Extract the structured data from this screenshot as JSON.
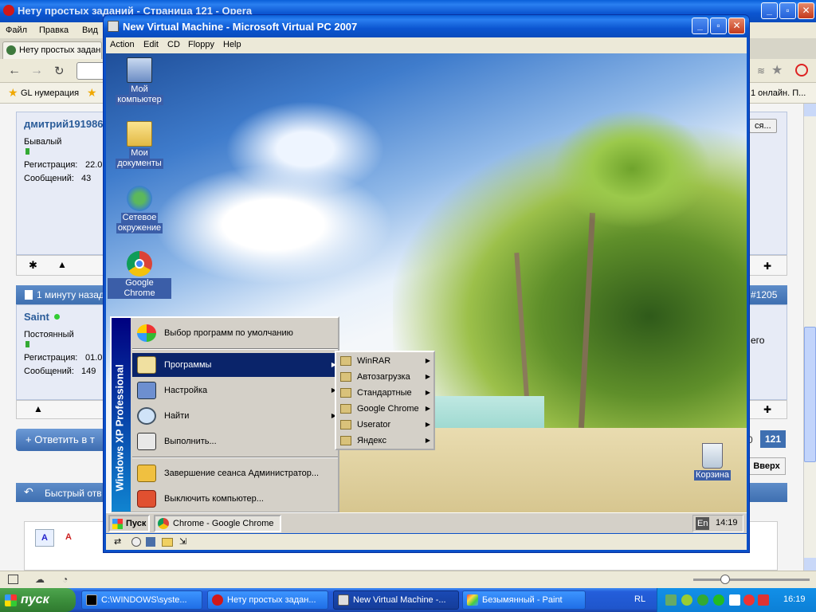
{
  "opera": {
    "window_title": "Нету простых заданий - Страница 121 - Opera",
    "menu": [
      "Файл",
      "Правка",
      "Вид"
    ],
    "tab_title": "Нету простых задан...",
    "bookmark": "GL нумерация",
    "status_right": "1 онлайн. П...",
    "button_right": "ся...",
    "post1": {
      "username": "дмитрий191986",
      "rank": "Бывалый",
      "reg_label": "Регистрация:",
      "reg_value": "22.0",
      "msgs_label": "Сообщений:",
      "msgs_value": "43"
    },
    "post2_header": "1 минуту назад",
    "post2_num": "#1205",
    "post2": {
      "username": "Saint",
      "rank": "Постоянный",
      "reg_label": "Регистрация:",
      "reg_value": "01.0",
      "msgs_label": "Сообщений:",
      "msgs_value": "149"
    },
    "right_text": "его",
    "reply_button": "+ Ответить в т",
    "page_prev": "0",
    "page_current": "121",
    "up_button": "Вверх",
    "quick_reply": "Быстрый отв"
  },
  "vpc": {
    "title": "New Virtual Machine - Microsoft Virtual PC 2007",
    "menu": [
      "Action",
      "Edit",
      "CD",
      "Floppy",
      "Help"
    ]
  },
  "desktop_icons": [
    {
      "label1": "Мой",
      "label2": "компьютер"
    },
    {
      "label1": "Мои",
      "label2": "документы"
    },
    {
      "label1": "Сетевое",
      "label2": "окружение"
    },
    {
      "label1": "Google Chrome",
      "label2": ""
    },
    {
      "label1": "Корзина",
      "label2": ""
    }
  ],
  "start_menu": {
    "banner": "Windows XP Professional",
    "items": [
      "Выбор программ по умолчанию",
      "Программы",
      "Настройка",
      "Найти",
      "Выполнить...",
      "Завершение сеанса Администратор...",
      "Выключить компьютер..."
    ]
  },
  "programs_submenu": [
    "WinRAR",
    "Автозагрузка",
    "Стандартные",
    "Google Chrome",
    "Userator",
    "Яндекс"
  ],
  "guest_taskbar": {
    "start": "Пуск",
    "task": "Chrome - Google Chrome",
    "lang": "En",
    "time": "14:19"
  },
  "host_taskbar": {
    "start": "пуск",
    "tasks": [
      "C:\\WINDOWS\\syste...",
      "Нету простых задан...",
      "New Virtual Machine -...",
      "Безымянный - Paint"
    ],
    "lang": "RL",
    "time": "16:19"
  }
}
